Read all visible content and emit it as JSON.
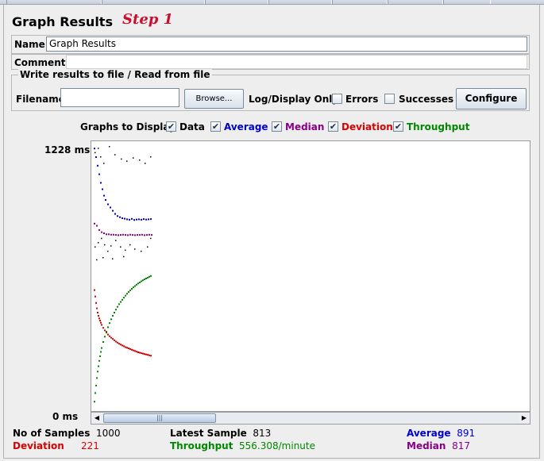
{
  "panel": {
    "title": "Graph Results",
    "step_label": "Step 1"
  },
  "name_field": {
    "label": "Name:",
    "value": "Graph Results"
  },
  "comments_field": {
    "label": "Comments:",
    "value": ""
  },
  "write_group": {
    "legend": "Write results to file / Read from file",
    "filename_label": "Filename",
    "filename_value": "",
    "browse_label": "Browse...",
    "log_display_label": "Log/Display Only:",
    "errors_label": "Errors",
    "errors_checked": false,
    "successes_label": "Successes",
    "successes_checked": false,
    "configure_label": "Configure"
  },
  "graphs_to_display": {
    "label": "Graphs to Display",
    "options": [
      {
        "label": "Data",
        "checked": true,
        "color": "#000000"
      },
      {
        "label": "Average",
        "checked": true,
        "color": "#0000cc"
      },
      {
        "label": "Median",
        "checked": true,
        "color": "#880088"
      },
      {
        "label": "Deviation",
        "checked": true,
        "color": "#dd0000"
      },
      {
        "label": "Throughput",
        "checked": true,
        "color": "#008800"
      }
    ]
  },
  "y_axis": {
    "max_label": "1228  ms",
    "min_label": "0  ms"
  },
  "colors": {
    "data": "#000000",
    "average": "#0000cc",
    "median": "#880088",
    "deviation": "#dd0000",
    "throughput": "#008800"
  },
  "stats": {
    "samples_label": "No of Samples",
    "samples_value": "1000",
    "latest_label": "Latest Sample",
    "latest_value": "813",
    "average_label": "Average",
    "average_value": "891",
    "deviation_label": "Deviation",
    "deviation_value": "221",
    "throughput_label": "Throughput",
    "throughput_value": "556.308/minute",
    "median_label": "Median",
    "median_value": "817"
  },
  "chart_data": {
    "type": "scatter",
    "ylim": [
      0,
      1228
    ],
    "series": [
      {
        "name": "Data",
        "x": [
          2,
          6,
          9,
          13,
          20,
          27,
          35,
          42,
          50,
          58,
          65,
          72,
          2,
          6,
          10,
          14,
          18,
          22,
          28,
          34,
          40,
          46,
          52,
          60,
          68,
          72,
          4,
          12,
          24,
          38
        ],
        "y": [
          1200,
          1220,
          1180,
          1150,
          1228,
          1190,
          1170,
          1160,
          1175,
          1165,
          1150,
          1180,
          760,
          780,
          800,
          770,
          740,
          765,
          790,
          760,
          745,
          770,
          750,
          740,
          760,
          800,
          700,
          710,
          705,
          715
        ]
      },
      {
        "name": "Average",
        "x": [
          1,
          3,
          5,
          7,
          9,
          11,
          13,
          15,
          18,
          21,
          24,
          27,
          30,
          33,
          36,
          39,
          42,
          45,
          48,
          51,
          54,
          57,
          60,
          63,
          66,
          69,
          72
        ],
        "y": [
          1220,
          1180,
          1140,
          1100,
          1060,
          1030,
          1000,
          980,
          960,
          945,
          930,
          915,
          905,
          900,
          895,
          893,
          890,
          888,
          892,
          887,
          889,
          890,
          888,
          891,
          889,
          890,
          891
        ]
      },
      {
        "name": "Median",
        "x": [
          1,
          4,
          7,
          10,
          13,
          16,
          19,
          22,
          25,
          28,
          31,
          34,
          37,
          40,
          43,
          46,
          49,
          52,
          55,
          58,
          61,
          64,
          67,
          70,
          73
        ],
        "y": [
          870,
          860,
          840,
          830,
          825,
          820,
          820,
          818,
          818,
          817,
          816,
          817,
          818,
          817,
          816,
          818,
          817,
          816,
          817,
          817,
          818,
          816,
          817,
          818,
          817
        ]
      },
      {
        "name": "Deviation",
        "x": [
          1,
          2,
          3,
          4,
          5,
          6,
          7,
          8,
          9,
          10,
          12,
          14,
          16,
          18,
          20,
          22,
          24,
          26,
          28,
          30,
          32,
          34,
          36,
          38,
          40,
          42,
          44,
          46,
          48,
          50,
          52,
          54,
          56,
          58,
          60,
          62,
          64,
          66,
          68,
          70,
          72
        ],
        "y": [
          560,
          530,
          500,
          475,
          455,
          440,
          428,
          418,
          408,
          398,
          384,
          372,
          362,
          353,
          345,
          338,
          332,
          326,
          320,
          315,
          310,
          306,
          302,
          298,
          294,
          291,
          288,
          285,
          282,
          279,
          276,
          273,
          270,
          268,
          266,
          264,
          262,
          260,
          258,
          256,
          254
        ]
      },
      {
        "name": "Throughput",
        "x": [
          1,
          2,
          3,
          4,
          5,
          6,
          7,
          8,
          9,
          10,
          12,
          14,
          16,
          18,
          20,
          22,
          24,
          26,
          28,
          30,
          32,
          34,
          36,
          38,
          40,
          42,
          44,
          46,
          48,
          50,
          52,
          54,
          56,
          58,
          60,
          62,
          64,
          66,
          68,
          70,
          72
        ],
        "y": [
          40,
          80,
          115,
          150,
          180,
          205,
          230,
          252,
          272,
          290,
          318,
          343,
          366,
          387,
          406,
          424,
          440,
          455,
          469,
          482,
          494,
          505,
          515,
          525,
          534,
          543,
          551,
          559,
          566,
          573,
          579,
          585,
          591,
          596,
          601,
          606,
          610,
          614,
          618,
          622,
          626
        ]
      }
    ]
  }
}
